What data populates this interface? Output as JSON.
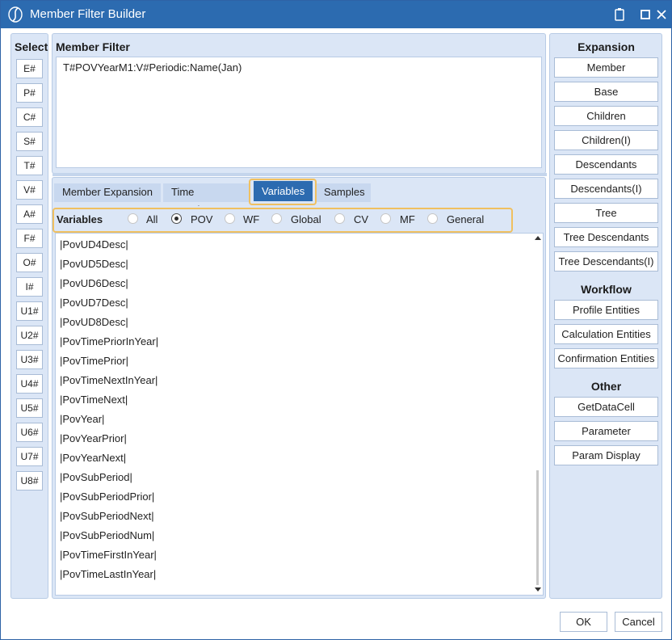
{
  "window": {
    "title": "Member Filter Builder"
  },
  "select_panel": {
    "title": "Select",
    "buttons": [
      "E#",
      "P#",
      "C#",
      "S#",
      "T#",
      "V#",
      "A#",
      "F#",
      "O#",
      "I#",
      "U1#",
      "U2#",
      "U3#",
      "U4#",
      "U5#",
      "U6#",
      "U7#",
      "U8#"
    ]
  },
  "member_filter": {
    "title": "Member Filter",
    "value": "T#POVYearM1:V#Periodic:Name(Jan)"
  },
  "tabs": [
    {
      "label": "Member Expansion",
      "active": false
    },
    {
      "label": "Time Functions",
      "active": false
    },
    {
      "label": "Variables",
      "active": true
    },
    {
      "label": "Samples",
      "active": false
    }
  ],
  "variables": {
    "label": "Variables",
    "options": [
      {
        "label": "All",
        "checked": false
      },
      {
        "label": "POV",
        "checked": true
      },
      {
        "label": "WF",
        "checked": false
      },
      {
        "label": "Global",
        "checked": false
      },
      {
        "label": "CV",
        "checked": false
      },
      {
        "label": "MF",
        "checked": false
      },
      {
        "label": "General",
        "checked": false
      }
    ],
    "items": [
      "|PovUD4Desc|",
      "|PovUD5Desc|",
      "|PovUD6Desc|",
      "|PovUD7Desc|",
      "|PovUD8Desc|",
      "|PovTimePriorInYear|",
      "|PovTimePrior|",
      "|PovTimeNextInYear|",
      "|PovTimeNext|",
      "|PovYear|",
      "|PovYearPrior|",
      "|PovYearNext|",
      "|PovSubPeriod|",
      "|PovSubPeriodPrior|",
      "|PovSubPeriodNext|",
      "|PovSubPeriodNum|",
      "|PovTimeFirstInYear|",
      "|PovTimeLastInYear|"
    ]
  },
  "expansion_panel": {
    "title": "Expansion",
    "buttons": [
      "Member",
      "Base",
      "Children",
      "Children(I)",
      "Descendants",
      "Descendants(I)",
      "Tree",
      "Tree Descendants",
      "Tree Descendants(I)"
    ],
    "workflow_title": "Workflow",
    "workflow_buttons": [
      "Profile Entities",
      "Calculation Entities",
      "Confirmation Entities"
    ],
    "other_title": "Other",
    "other_buttons": [
      "GetDataCell",
      "Parameter",
      "Param Display"
    ]
  },
  "footer": {
    "ok_label": "OK",
    "cancel_label": "Cancel"
  }
}
